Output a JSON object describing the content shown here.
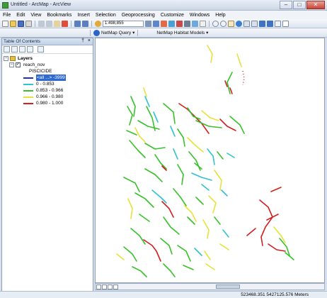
{
  "window": {
    "title": "Untitled - ArcMap - ArcView",
    "minimize": "–",
    "maximize": "□",
    "close": "✕"
  },
  "menu": [
    "File",
    "Edit",
    "View",
    "Bookmarks",
    "Insert",
    "Selection",
    "Geoprocessing",
    "Customize",
    "Windows",
    "Help"
  ],
  "toolbar": {
    "scale": "1:498,855",
    "netmap_query": "NetMap Query ▾",
    "netmap_habitat": "NetMap Habitat Models ▾"
  },
  "toc": {
    "title": "Table Of Contents",
    "pin": "†",
    "close": "×",
    "layers_label": "Layers",
    "layer_name": "reach_nov",
    "field_name": "PISCICIDE",
    "legend": [
      {
        "label": "<all other values>",
        "display": "<all ...> -3999",
        "color": "#1f2fbf"
      },
      {
        "label": "0 - 0.853",
        "color": "#2ec3cf"
      },
      {
        "label": "0.853 - 0.966",
        "color": "#38c22a"
      },
      {
        "label": "0.966 - 0.980",
        "color": "#e6e23a"
      },
      {
        "label": "0.980 - 1.000",
        "color": "#d21f1f"
      }
    ]
  },
  "status": {
    "coordinates": "523468.351  5427125.576 Meters"
  },
  "map_view": {
    "stream_classes": [
      "0 - 0.853",
      "0.853 - 0.966",
      "0.966 - 0.980",
      "0.980 - 1.000"
    ]
  }
}
